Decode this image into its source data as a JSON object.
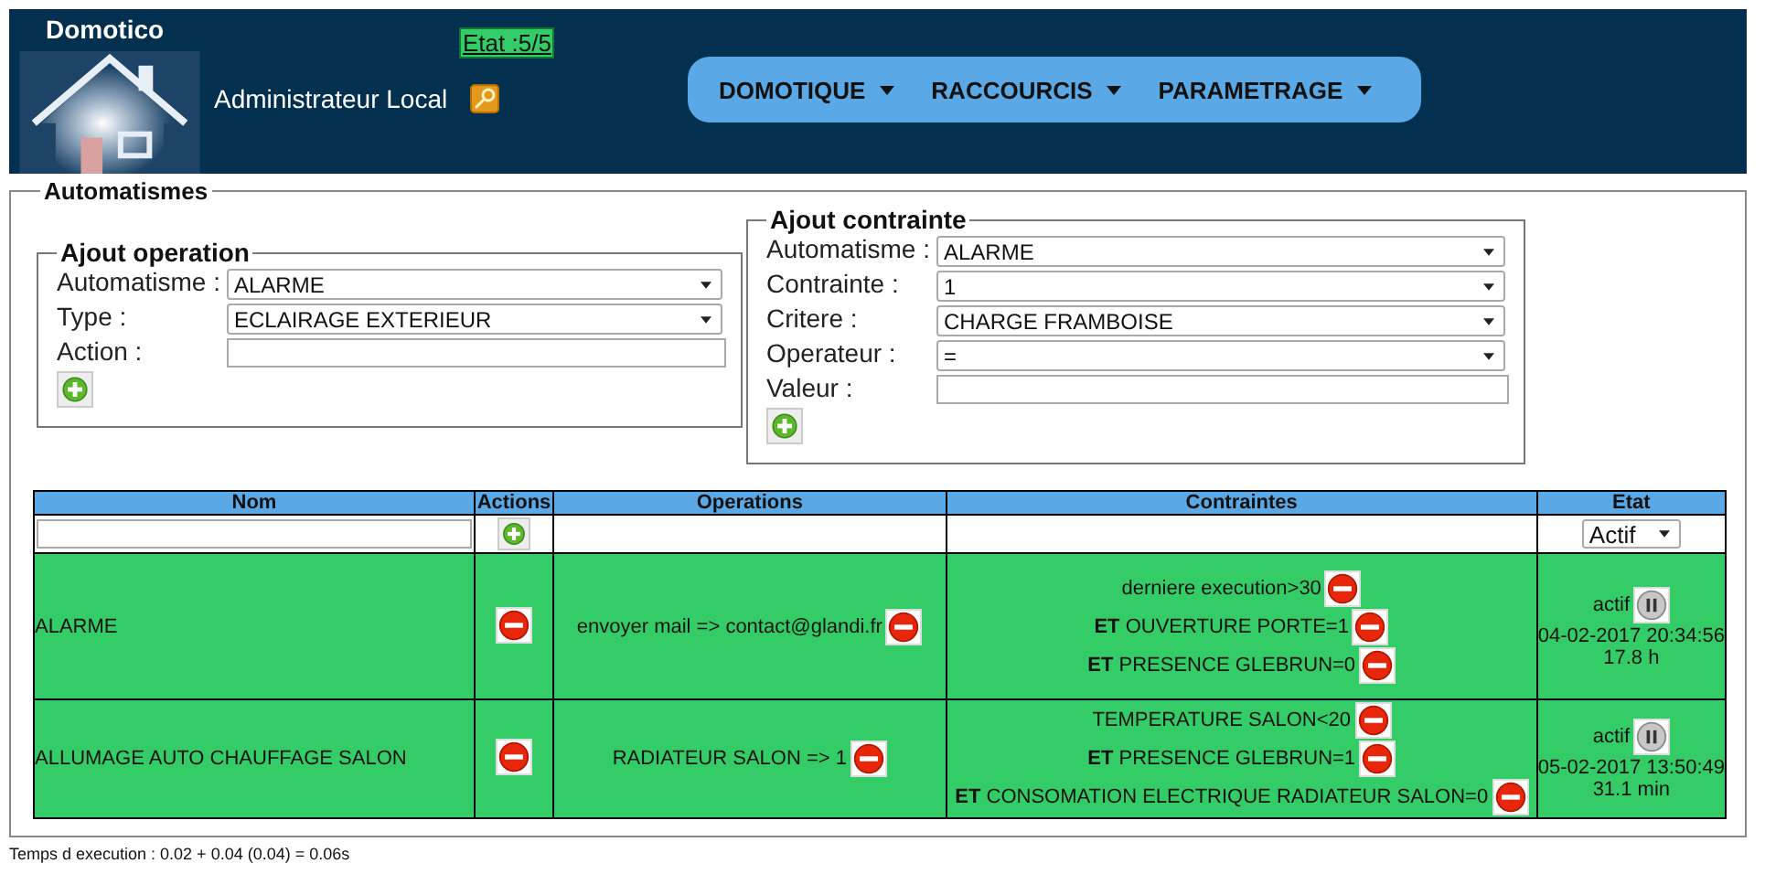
{
  "header": {
    "title": "Domotico",
    "status": "Etat :5/5",
    "user": "Administrateur Local"
  },
  "nav": [
    {
      "label": "DOMOTIQUE"
    },
    {
      "label": "RACCOURCIS"
    },
    {
      "label": "PARAMETRAGE"
    }
  ],
  "section": {
    "legend": "Automatismes"
  },
  "ajout_operation": {
    "legend": "Ajout operation",
    "fields": [
      {
        "label": "Automatisme :",
        "kind": "select",
        "value": "ALARME"
      },
      {
        "label": "Type :",
        "kind": "select",
        "value": "ECLAIRAGE EXTERIEUR"
      },
      {
        "label": "Action :",
        "kind": "input"
      }
    ]
  },
  "ajout_contrainte": {
    "legend": "Ajout contrainte",
    "fields": [
      {
        "label": "Automatisme :",
        "kind": "select",
        "value": "ALARME"
      },
      {
        "label": "Contrainte :",
        "kind": "select",
        "value": "1"
      },
      {
        "label": "Critere :",
        "kind": "select",
        "value": "CHARGE FRAMBOISE"
      },
      {
        "label": "Operateur :",
        "kind": "select",
        "value": "="
      },
      {
        "label": "Valeur :",
        "kind": "input"
      }
    ]
  },
  "table": {
    "columns": [
      "Nom",
      "Actions",
      "Operations",
      "Contraintes",
      "Etat"
    ],
    "filter": {
      "etat": "Actif"
    },
    "rows": [
      {
        "nom": "ALARME",
        "operations": [
          "envoyer mail => contact@glandi.fr"
        ],
        "contraintes": [
          "derniere execution>30",
          "**ET** OUVERTURE PORTE=1",
          "**ET** PRESENCE GLEBRUN=0"
        ],
        "etat": "actif",
        "date": "04-02-2017 20:34:56",
        "duree": "17.8 h"
      },
      {
        "nom": "ALLUMAGE AUTO CHAUFFAGE SALON",
        "operations": [
          "RADIATEUR SALON => 1"
        ],
        "contraintes": [
          "TEMPERATURE SALON<20",
          "**ET** PRESENCE GLEBRUN=1",
          "**ET** CONSOMATION ELECTRIQUE RADIATEUR SALON=0"
        ],
        "etat": "actif",
        "date": "05-02-2017 13:50:49",
        "duree": "31.1 min"
      }
    ]
  },
  "footer": "Temps d execution : 0.02 + 0.04 (0.04) = 0.06s"
}
